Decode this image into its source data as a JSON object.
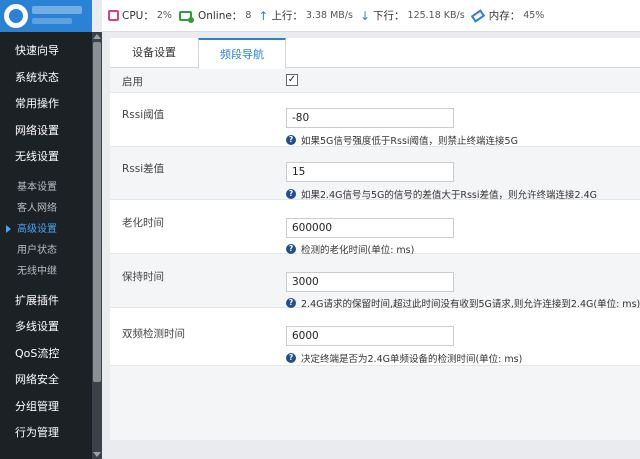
{
  "sidebar": {
    "menu": [
      {
        "label": "快速向导",
        "type": "main"
      },
      {
        "label": "系统状态",
        "type": "main"
      },
      {
        "label": "常用操作",
        "type": "main"
      },
      {
        "label": "网络设置",
        "type": "main"
      },
      {
        "label": "无线设置",
        "type": "main"
      }
    ],
    "submenu": [
      {
        "label": "基本设置",
        "active": false
      },
      {
        "label": "客人网络",
        "active": false
      },
      {
        "label": "高级设置",
        "active": true
      },
      {
        "label": "用户状态",
        "active": false
      },
      {
        "label": "无线中继",
        "active": false
      }
    ],
    "menu2": [
      {
        "label": "扩展插件"
      },
      {
        "label": "多线设置"
      },
      {
        "label": "QoS流控"
      },
      {
        "label": "网络安全"
      },
      {
        "label": "分组管理"
      },
      {
        "label": "行为管理"
      }
    ]
  },
  "topbar": {
    "cpu_label": "CPU：",
    "cpu_value": "2%",
    "online_label": "Online：",
    "online_value": "8",
    "up_label": "上行：",
    "up_value": "3.38 MB/s",
    "down_label": "下行：",
    "down_value": "125.18 KB/s",
    "mem_label": "内存：",
    "mem_value": "45%"
  },
  "tabs": [
    {
      "label": "设备设置",
      "active": false
    },
    {
      "label": "频段导航",
      "active": true
    }
  ],
  "form": {
    "enable_label": "启用",
    "enable_checked": "✓",
    "rssi_threshold_label": "Rssi阈值",
    "rssi_threshold_value": "-80",
    "rssi_threshold_hint": "如果5G信号强度低于Rssi阈值，则禁止终端连接5G",
    "rssi_diff_label": "Rssi差值",
    "rssi_diff_value": "15",
    "rssi_diff_hint": "如果2.4G信号与5G的信号的差值大于Rssi差值，则允许终端连接2.4G",
    "aging_label": "老化时间",
    "aging_value": "600000",
    "aging_hint": "检测的老化时间(单位: ms)",
    "hold_label": "保持时间",
    "hold_value": "3000",
    "hold_hint": "2.4G请求的保留时间,超过此时间没有收到5G请求,则允许连接到2.4G(单位: ms)",
    "dual_label": "双频检测时间",
    "dual_value": "6000",
    "dual_hint": "决定终端是否为2.4G单频设备的检测时间(单位: ms)"
  },
  "icons": {
    "help": "?"
  },
  "colors": {
    "accent": "#2a82d4",
    "sidebar_bg": "#1c2126",
    "active_sub": "#4aa3f0"
  }
}
